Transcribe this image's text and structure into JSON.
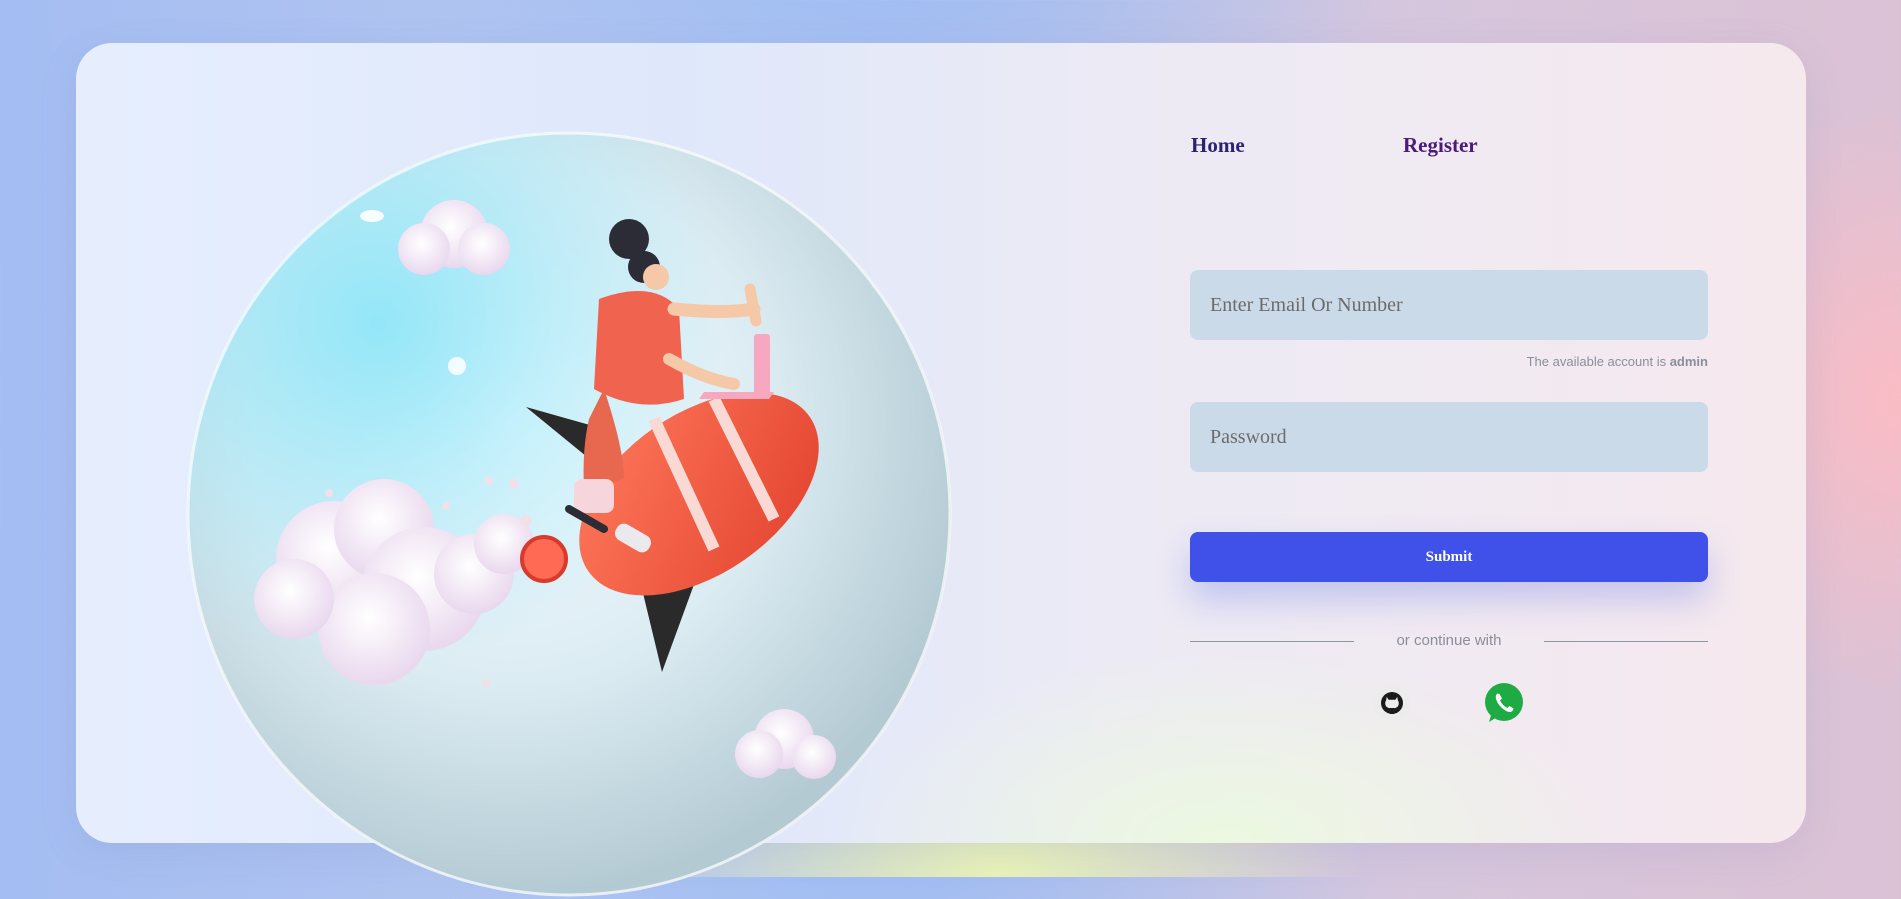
{
  "nav": {
    "home_label": "Home",
    "register_label": "Register"
  },
  "form": {
    "email_placeholder": "Enter Email Or Number",
    "hint_prefix": "The available account is ",
    "hint_account": "admin",
    "password_placeholder": "Password",
    "submit_label": "Submit"
  },
  "divider": {
    "label": "or continue with"
  },
  "social": {
    "icons": [
      "github-icon",
      "whatsapp-icon"
    ]
  },
  "colors": {
    "submit": "#3f51e8",
    "input_bg": "#cbdae9",
    "whatsapp": "#1fab44"
  }
}
